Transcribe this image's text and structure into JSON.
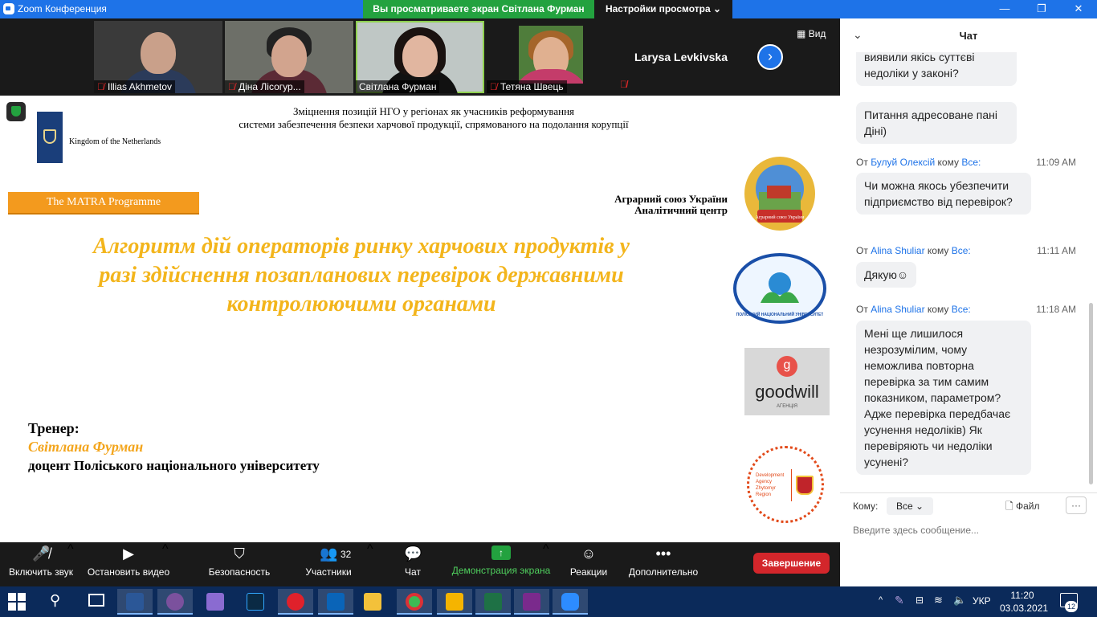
{
  "window": {
    "title": "Zoom Конференция",
    "share_banner": "Вы просматриваете экран Світлана Фурман",
    "view_settings": "Настройки просмотра",
    "minimize": "—",
    "restore": "❐",
    "close": "✕"
  },
  "participants": [
    {
      "name": "Illias Akhmetov",
      "muted": true
    },
    {
      "name": "Діна Лісогур...",
      "muted": true
    },
    {
      "name": "Світлана Фурман",
      "muted": false
    },
    {
      "name": "Тетяна Швець",
      "muted": true
    },
    {
      "name": "Larysa Levkivska",
      "muted": true
    }
  ],
  "video": {
    "view_label": "Вид",
    "next_icon": "›"
  },
  "slide": {
    "header_line1": "Зміцнення позицій НГО у регіонах як учасників реформування",
    "header_line2": "системи забезпечення безпеки харчової продукції, спрямованого на подолання корупції",
    "netherlands": "Kingdom of the Netherlands",
    "matra": "The MATRA Programme",
    "agro_line1": "Аграрний союз України",
    "agro_line2": "Аналітичний центр",
    "agro_logo_caption": "Аграрний союз України",
    "polis_logo_text": "ПОЛІСЬКИЙ НАЦІОНАЛЬНИЙ УНІВЕРСИТЕТ",
    "goodwill": "goodwill",
    "goodwill_sub": "АГЕНЦІЯ",
    "dev_agency": "Development Agency Zhytomyr Region",
    "title_line1": "Алгоритм дій операторів ринку харчових продуктів у",
    "title_line2": "разі здійснення позапланових перевірок державними",
    "title_line3": "контролюючими органами",
    "trainer_label": "Тренер:",
    "trainer_name": "Світлана  Фурман",
    "trainer_role": "доцент Поліського національного університету"
  },
  "chat": {
    "title": "Чат",
    "messages": [
      {
        "text_partial": "скажіть, будь ласка, чи ви виявили якісь суттєві недоліки у законі?"
      },
      {
        "text": "Питання адресоване пані Діні)"
      },
      {
        "from_prefix": "От",
        "from": "Булуй Олексій",
        "to_prefix": "кому",
        "to": "Все:",
        "time": "11:09 AM",
        "text": "Чи можна якось убезпечити підприємство від перевірок?"
      },
      {
        "from_prefix": "От",
        "from": "Alina Shuliar",
        "to_prefix": "кому",
        "to": "Все:",
        "time": "11:11 AM",
        "text": "Дякую☺"
      },
      {
        "from_prefix": "От",
        "from": "Alina Shuliar",
        "to_prefix": "кому",
        "to": "Все:",
        "time": "11:18 AM",
        "text": "Мені ще лишилося незрозумілим, чому неможлива повторна перевірка за тим самим показником, параметром? Адже перевірка передбачає усунення недоліків) Як перевіряють чи недоліки усунені?"
      }
    ],
    "to_label": "Кому:",
    "to_value": "Все",
    "file_label": "Файл",
    "more_label": "···",
    "input_placeholder": "Введите здесь сообщение..."
  },
  "toolbar": {
    "unmute": "Включить звук",
    "stop_video": "Остановить видео",
    "security": "Безопасность",
    "participants": "Участники",
    "participants_count": "32",
    "chat": "Чат",
    "share_screen": "Демонстрация экрана",
    "reactions": "Реакции",
    "more": "Дополнительно",
    "end": "Завершение"
  },
  "taskbar": {
    "language": "УКР",
    "time": "11:20",
    "date": "03.03.2021",
    "notifications": "12"
  },
  "colors": {
    "zoom_blue": "#1e73e8",
    "share_green": "#23a23f",
    "end_red": "#d3262b",
    "slide_title_gold": "#f3b51c",
    "matra_orange": "#f39a1e"
  }
}
